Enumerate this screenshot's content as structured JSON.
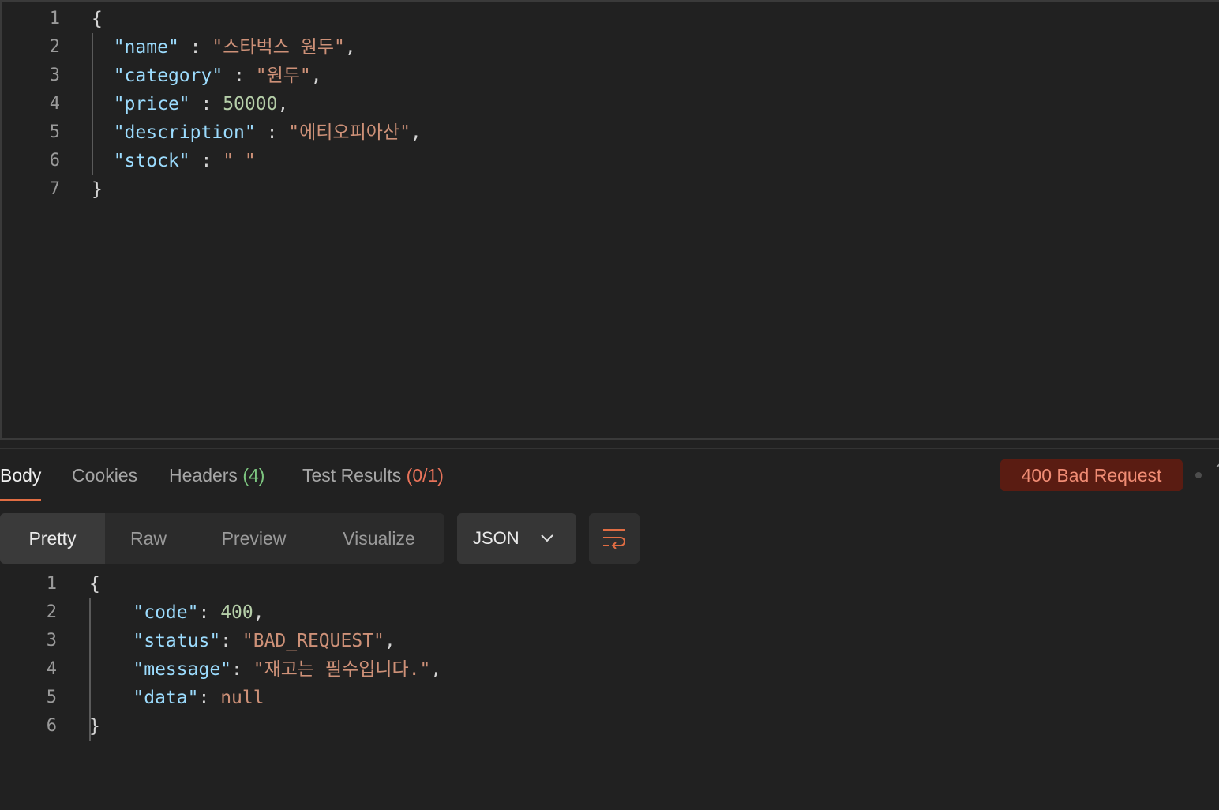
{
  "request_body": {
    "lines": [
      {
        "no": "1",
        "parts": [
          {
            "t": "{",
            "c": "punc"
          }
        ]
      },
      {
        "no": "2",
        "parts": [
          {
            "t": "  ",
            "c": "punc"
          },
          {
            "t": "\"name\"",
            "c": "key"
          },
          {
            "t": " : ",
            "c": "punc"
          },
          {
            "t": "\"스타벅스 원두\"",
            "c": "str"
          },
          {
            "t": ",",
            "c": "punc"
          }
        ]
      },
      {
        "no": "3",
        "parts": [
          {
            "t": "  ",
            "c": "punc"
          },
          {
            "t": "\"category\"",
            "c": "key"
          },
          {
            "t": " : ",
            "c": "punc"
          },
          {
            "t": "\"원두\"",
            "c": "str"
          },
          {
            "t": ",",
            "c": "punc"
          }
        ]
      },
      {
        "no": "4",
        "parts": [
          {
            "t": "  ",
            "c": "punc"
          },
          {
            "t": "\"price\"",
            "c": "key"
          },
          {
            "t": " : ",
            "c": "punc"
          },
          {
            "t": "50000",
            "c": "num"
          },
          {
            "t": ",",
            "c": "punc"
          }
        ]
      },
      {
        "no": "5",
        "parts": [
          {
            "t": "  ",
            "c": "punc"
          },
          {
            "t": "\"description\"",
            "c": "key"
          },
          {
            "t": " : ",
            "c": "punc"
          },
          {
            "t": "\"에티오피아산\"",
            "c": "str"
          },
          {
            "t": ",",
            "c": "punc"
          }
        ]
      },
      {
        "no": "6",
        "parts": [
          {
            "t": "  ",
            "c": "punc"
          },
          {
            "t": "\"stock\"",
            "c": "key"
          },
          {
            "t": " : ",
            "c": "punc"
          },
          {
            "t": "\" \"",
            "c": "str"
          }
        ]
      },
      {
        "no": "7",
        "parts": [
          {
            "t": "}",
            "c": "punc"
          }
        ]
      }
    ]
  },
  "response": {
    "tabs": [
      {
        "label": "Body",
        "count": "",
        "count_color": ""
      },
      {
        "label": "Cookies",
        "count": "",
        "count_color": ""
      },
      {
        "label": "Headers",
        "count": "(4)",
        "count_color": "green"
      },
      {
        "label": "Test Results",
        "count": "(0/1)",
        "count_color": "red"
      }
    ],
    "status": "400 Bad Request",
    "views": [
      "Pretty",
      "Raw",
      "Preview",
      "Visualize"
    ],
    "format": "JSON",
    "colors": {
      "accent": "#e16d43",
      "status_bg": "#5a1c12",
      "status_text": "#f08c74"
    },
    "icons": {
      "format_dropdown": "chevron-down-icon",
      "wrap": "wrap-lines-icon",
      "more": "arrow-icon"
    },
    "body": {
      "lines": [
        {
          "no": "1",
          "parts": [
            {
              "t": "{",
              "c": "punc"
            }
          ]
        },
        {
          "no": "2",
          "parts": [
            {
              "t": "    ",
              "c": "punc"
            },
            {
              "t": "\"code\"",
              "c": "key"
            },
            {
              "t": ": ",
              "c": "punc"
            },
            {
              "t": "400",
              "c": "num"
            },
            {
              "t": ",",
              "c": "punc"
            }
          ]
        },
        {
          "no": "3",
          "parts": [
            {
              "t": "    ",
              "c": "punc"
            },
            {
              "t": "\"status\"",
              "c": "key"
            },
            {
              "t": ": ",
              "c": "punc"
            },
            {
              "t": "\"BAD_REQUEST\"",
              "c": "str"
            },
            {
              "t": ",",
              "c": "punc"
            }
          ]
        },
        {
          "no": "4",
          "parts": [
            {
              "t": "    ",
              "c": "punc"
            },
            {
              "t": "\"message\"",
              "c": "key"
            },
            {
              "t": ": ",
              "c": "punc"
            },
            {
              "t": "\"재고는 필수입니다.\"",
              "c": "str"
            },
            {
              "t": ",",
              "c": "punc"
            }
          ]
        },
        {
          "no": "5",
          "parts": [
            {
              "t": "    ",
              "c": "punc"
            },
            {
              "t": "\"data\"",
              "c": "key"
            },
            {
              "t": ": ",
              "c": "punc"
            },
            {
              "t": "null",
              "c": "null"
            }
          ]
        },
        {
          "no": "6",
          "parts": [
            {
              "t": "}",
              "c": "punc"
            }
          ]
        }
      ]
    }
  }
}
